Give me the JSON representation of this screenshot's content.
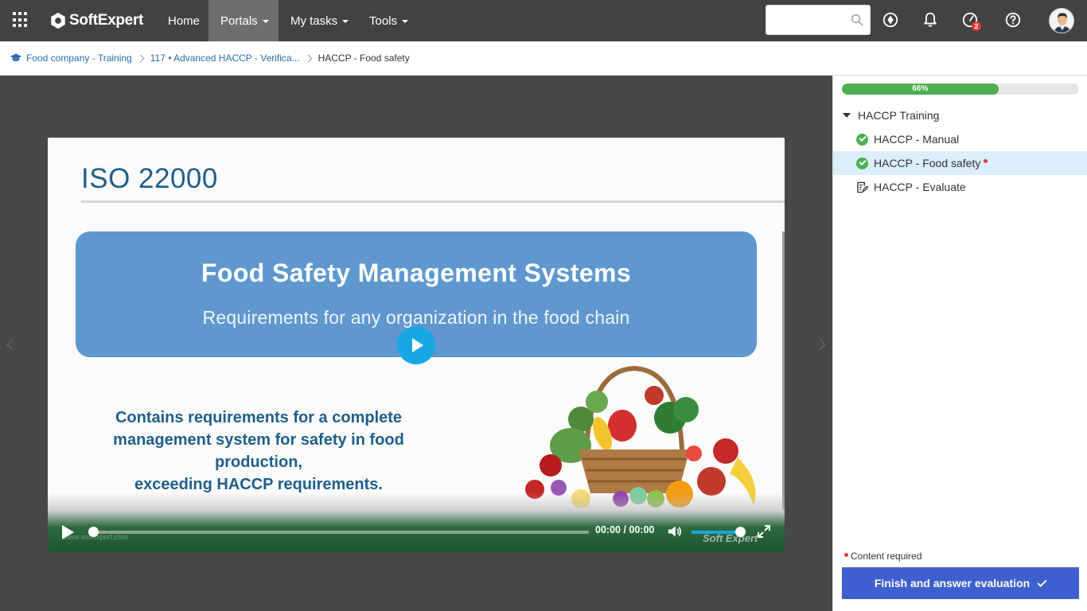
{
  "topbar": {
    "brand": "SoftExpert",
    "nav": [
      "Home",
      "Portals",
      "My tasks",
      "Tools"
    ],
    "active_nav": "Portals",
    "search_placeholder": "",
    "notification_count": "2",
    "icons": [
      "apps-grid-icon",
      "search-icon",
      "compass-icon",
      "bell-icon",
      "gauge-icon",
      "help-icon",
      "avatar"
    ]
  },
  "breadcrumb": {
    "items": [
      "Food company - Training",
      "117 • Advanced HACCP - Verifica...",
      "HACCP - Food safety"
    ]
  },
  "slide": {
    "title": "ISO 22000",
    "banner_heading": "Food Safety Management Systems",
    "banner_sub": "Requirements for any organization in the food chain",
    "body_line1": "Contains requirements for a complete",
    "body_line2": "management system for safety in food production,",
    "body_line3": "exceeding HACCP requirements.",
    "watermark_url": "www.softexpert.com",
    "watermark_logo": "Soft Expert"
  },
  "player": {
    "time": "00:00 / 00:00",
    "progress": 0,
    "volume": 0.9
  },
  "side": {
    "progress_label": "66%",
    "progress_value": 0.66,
    "tree_root": "HACCP Training",
    "items": [
      {
        "label": "HACCP - Manual",
        "status": "done"
      },
      {
        "label": "HACCP - Food safety",
        "status": "done",
        "required": true
      },
      {
        "label": "HACCP - Evaluate",
        "status": "evaluation"
      }
    ],
    "legend": "Content required",
    "finish_button": "Finish and answer evaluation"
  },
  "colors": {
    "topbar": "#424242",
    "accent_blue": "#3d5fcf",
    "success": "#4caf50",
    "required": "#e53935",
    "slide_banner": "#5f98ce",
    "play_button": "#18a7e6"
  }
}
